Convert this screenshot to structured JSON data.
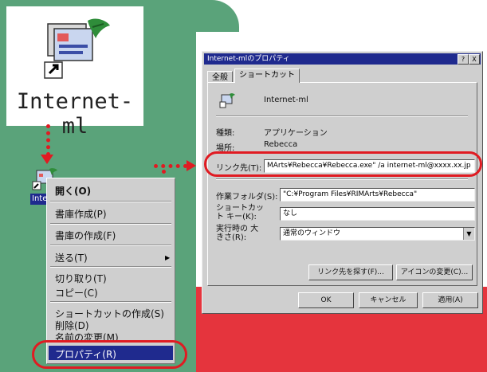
{
  "colors": {
    "green": "#5aa37a",
    "red": "#e5343d",
    "accent": "#e01b22",
    "selection": "#1f2a8e"
  },
  "shortcut_icon": {
    "label": "Internet-ml",
    "desktop_label": "Interne",
    "icon": "internet-ml-app-icon"
  },
  "context_menu": {
    "items": [
      {
        "label": "開く(O)",
        "bold": true
      },
      {
        "label": "書庫作成(P)"
      },
      {
        "label": "書庫の作成(F)"
      },
      {
        "label": "送る(T)",
        "submenu": true
      },
      {
        "label": "切り取り(T)"
      },
      {
        "label": "コピー(C)"
      },
      {
        "label": "ショートカットの作成(S)"
      },
      {
        "label": "削除(D)"
      },
      {
        "label": "名前の変更(M)"
      },
      {
        "label": "プロパティ(R)",
        "selected": true
      }
    ]
  },
  "dialog": {
    "title": "Internet-mlのプロパティ",
    "title_buttons": [
      "?",
      "X"
    ],
    "tabs": [
      "全般",
      "ショートカット"
    ],
    "name": "Internet-ml",
    "fields": {
      "type_label": "種類:",
      "type_value": "アプリケーション",
      "location_label": "場所:",
      "location_value": "Rebecca",
      "target_label": "リンク先(T):",
      "target_value": "MArts¥Rebecca¥Rebecca.exe\" /a internet-ml@xxxx.xx.jp",
      "workdir_label": "作業フォルダ(S):",
      "workdir_value": "\"C:¥Program Files¥RIMArts¥Rebecca\"",
      "shortcut_key_label": "ショートカット キー(K):",
      "shortcut_key_value": "なし",
      "run_label": "実行時の 大きさ(R):",
      "run_value": "通常のウィンドウ"
    },
    "buttons": {
      "find_target": "リンク先を探す(F)...",
      "change_icon": "アイコンの変更(C)...",
      "ok": "OK",
      "cancel": "キャンセル",
      "apply": "適用(A)"
    }
  }
}
